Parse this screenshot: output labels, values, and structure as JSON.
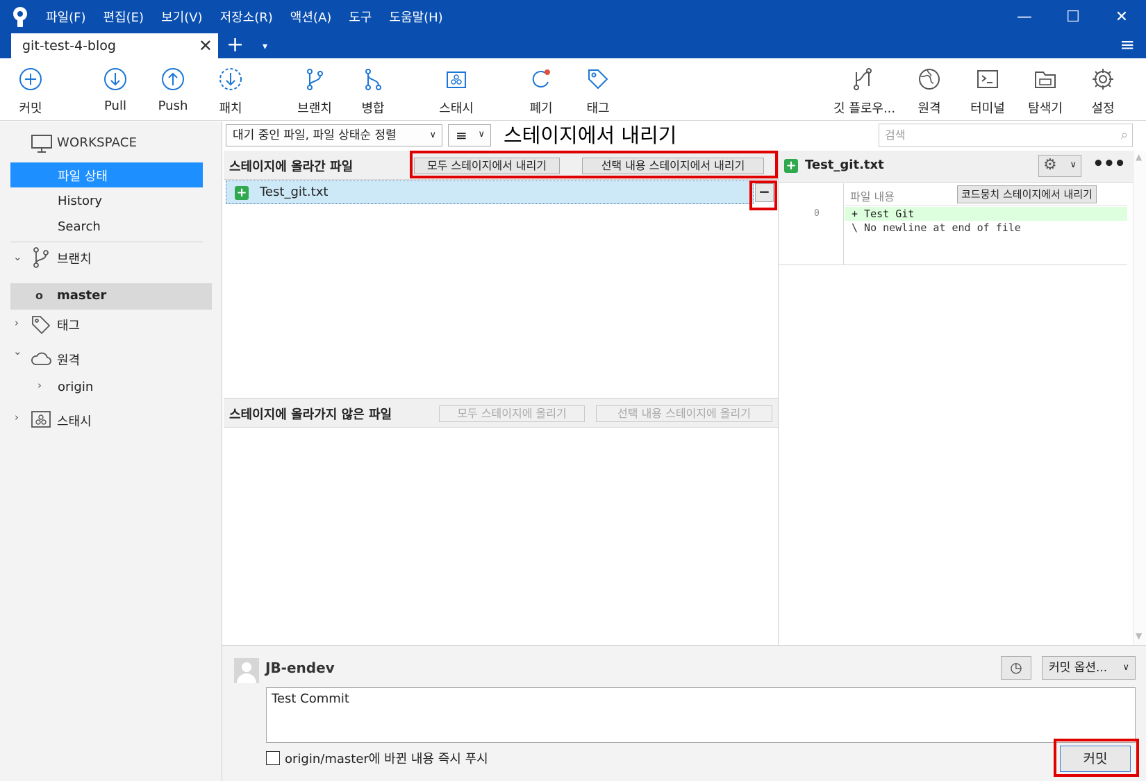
{
  "menu": [
    "파일(F)",
    "편집(E)",
    "보기(V)",
    "저장소(R)",
    "액션(A)",
    "도구",
    "도움말(H)"
  ],
  "window_controls": {
    "minimize": "—",
    "maximize": "☐",
    "close": "✕"
  },
  "tab": {
    "title": "git-test-4-blog",
    "close": "✕",
    "add": "+",
    "dropdown": "▾",
    "menu": "≡"
  },
  "toolbar": {
    "commit": "커밋",
    "pull": "Pull",
    "push": "Push",
    "fetch": "패치",
    "branch": "브랜치",
    "merge": "병합",
    "stash": "스태시",
    "discard": "폐기",
    "tag": "태그",
    "gitflow": "깃 플로우...",
    "remote": "원격",
    "terminal": "터미널",
    "explorer": "탐색기",
    "settings": "설정"
  },
  "sidebar": {
    "workspace": "WORKSPACE",
    "file_status": "파일 상태",
    "history": "History",
    "search": "Search",
    "branches": "브랜치",
    "master": "master",
    "tags": "태그",
    "remotes": "원격",
    "origin": "origin",
    "stashes": "스태시"
  },
  "filterbar": {
    "sort": "대기 중인 파일, 파일 상태순 정렬",
    "view_icon": "≡",
    "annotation": "스테이지에서 내리기",
    "search_placeholder": "검색"
  },
  "staged": {
    "title": "스테이지에 올라간 파일",
    "unstage_all": "모두 스테이지에서 내리기",
    "unstage_selected": "선택 내용 스테이지에서 내리기",
    "files": [
      {
        "name": "Test_git.txt",
        "status": "added"
      }
    ],
    "unstage_btn": "−"
  },
  "unstaged": {
    "title": "스테이지에 올라가지 않은 파일",
    "stage_all": "모두 스테이지에 올리기",
    "stage_selected": "선택 내용 스테이지에 올리기"
  },
  "diff": {
    "file_name": "Test_git.txt",
    "more": "•••",
    "hunk_title": "파일 내용",
    "hunk_unstage": "코드뭉치 스테이지에서 내리기",
    "line_no": "0",
    "added_line": "+ Test Git",
    "meta_line": "\\ No newline at end of file"
  },
  "commit": {
    "author": "JB-endev",
    "message": "Test Commit",
    "options": "커밋 옵션...",
    "push_label": "origin/master에 바뀐 내용 즉시 푸시",
    "push_checked": false,
    "commit_button": "커밋"
  },
  "colors": {
    "titlebar": "#0a4fb0",
    "selection": "#1e8fff",
    "added": "#2fa84f",
    "highlight": "#e00000"
  }
}
